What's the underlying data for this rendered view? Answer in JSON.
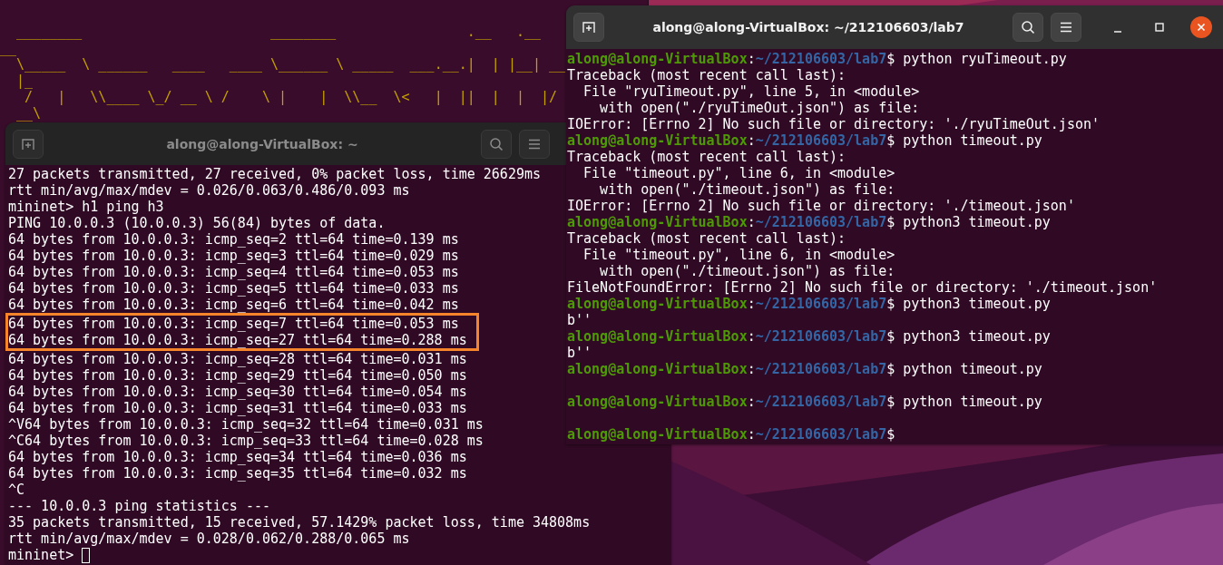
{
  "background_terminal": {
    "ascii_lines": [
      "  ________                       ________                .__   .__",
      "__",
      "  \\_____  \\ ______   ____   ____ \\______ \\ _____  ___.__.|  | |__| __",
      "  |_",
      "   /   |   \\\\____ \\_/ __ \\ /    \\ |    |  \\\\__  \\<   |  ||  |  |  |/",
      "  __\\"
    ]
  },
  "left_window": {
    "title": "along@along-VirtualBox: ~",
    "active": false,
    "cursor": true,
    "lines": [
      {
        "text": "27 packets transmitted, 27 received, 0% packet loss, time 26629ms",
        "highlighted": false
      },
      {
        "text": "rtt min/avg/max/mdev = 0.026/0.063/0.486/0.093 ms",
        "highlighted": false
      },
      {
        "text": "mininet> h1 ping h3",
        "highlighted": false
      },
      {
        "text": "PING 10.0.0.3 (10.0.0.3) 56(84) bytes of data.",
        "highlighted": false
      },
      {
        "text": "64 bytes from 10.0.0.3: icmp_seq=2 ttl=64 time=0.139 ms",
        "highlighted": false
      },
      {
        "text": "64 bytes from 10.0.0.3: icmp_seq=3 ttl=64 time=0.029 ms",
        "highlighted": false
      },
      {
        "text": "64 bytes from 10.0.0.3: icmp_seq=4 ttl=64 time=0.053 ms",
        "highlighted": false
      },
      {
        "text": "64 bytes from 10.0.0.3: icmp_seq=5 ttl=64 time=0.033 ms",
        "highlighted": false
      },
      {
        "text": "64 bytes from 10.0.0.3: icmp_seq=6 ttl=64 time=0.042 ms",
        "highlighted": false
      },
      {
        "text": "64 bytes from 10.0.0.3: icmp_seq=7 ttl=64 time=0.053 ms",
        "highlighted": true
      },
      {
        "text": "64 bytes from 10.0.0.3: icmp_seq=27 ttl=64 time=0.288 ms",
        "highlighted": true
      },
      {
        "text": "64 bytes from 10.0.0.3: icmp_seq=28 ttl=64 time=0.031 ms",
        "highlighted": false
      },
      {
        "text": "64 bytes from 10.0.0.3: icmp_seq=29 ttl=64 time=0.050 ms",
        "highlighted": false
      },
      {
        "text": "64 bytes from 10.0.0.3: icmp_seq=30 ttl=64 time=0.054 ms",
        "highlighted": false
      },
      {
        "text": "64 bytes from 10.0.0.3: icmp_seq=31 ttl=64 time=0.033 ms",
        "highlighted": false
      },
      {
        "text": "^V64 bytes from 10.0.0.3: icmp_seq=32 ttl=64 time=0.031 ms",
        "highlighted": false
      },
      {
        "text": "^C64 bytes from 10.0.0.3: icmp_seq=33 ttl=64 time=0.028 ms",
        "highlighted": false
      },
      {
        "text": "64 bytes from 10.0.0.3: icmp_seq=34 ttl=64 time=0.036 ms",
        "highlighted": false
      },
      {
        "text": "64 bytes from 10.0.0.3: icmp_seq=35 ttl=64 time=0.032 ms",
        "highlighted": false
      },
      {
        "text": "^C",
        "highlighted": false
      },
      {
        "text": "--- 10.0.0.3 ping statistics ---",
        "highlighted": false
      },
      {
        "text": "35 packets transmitted, 15 received, 57.1429% packet loss, time 34808ms",
        "highlighted": false
      },
      {
        "text": "rtt min/avg/max/mdev = 0.028/0.062/0.288/0.065 ms",
        "highlighted": false
      },
      {
        "text": "mininet> ",
        "highlighted": false
      }
    ]
  },
  "right_window": {
    "title": "along@along-VirtualBox: ~/212106603/lab7",
    "active": true,
    "lines": [
      {
        "kind": "prompt",
        "user": "along@along-VirtualBox",
        "separator": ":",
        "path": "~/212106603/lab7",
        "command": "$ python ryuTimeout.py"
      },
      {
        "kind": "output",
        "text": "Traceback (most recent call last):"
      },
      {
        "kind": "output",
        "text": "  File \"ryuTimeout.py\", line 5, in <module>"
      },
      {
        "kind": "output",
        "text": "    with open(\"./ryuTimeOut.json\") as file:"
      },
      {
        "kind": "output",
        "text": "IOError: [Errno 2] No such file or directory: './ryuTimeOut.json'"
      },
      {
        "kind": "prompt",
        "user": "along@along-VirtualBox",
        "separator": ":",
        "path": "~/212106603/lab7",
        "command": "$ python timeout.py"
      },
      {
        "kind": "output",
        "text": "Traceback (most recent call last):"
      },
      {
        "kind": "output",
        "text": "  File \"timeout.py\", line 6, in <module>"
      },
      {
        "kind": "output",
        "text": "    with open(\"./timeout.json\") as file:"
      },
      {
        "kind": "output",
        "text": "IOError: [Errno 2] No such file or directory: './timeout.json'"
      },
      {
        "kind": "prompt",
        "user": "along@along-VirtualBox",
        "separator": ":",
        "path": "~/212106603/lab7",
        "command": "$ python3 timeout.py"
      },
      {
        "kind": "output",
        "text": "Traceback (most recent call last):"
      },
      {
        "kind": "output",
        "text": "  File \"timeout.py\", line 6, in <module>"
      },
      {
        "kind": "output",
        "text": "    with open(\"./timeout.json\") as file:"
      },
      {
        "kind": "output",
        "text": "FileNotFoundError: [Errno 2] No such file or directory: './timeout.json'"
      },
      {
        "kind": "prompt",
        "user": "along@along-VirtualBox",
        "separator": ":",
        "path": "~/212106603/lab7",
        "command": "$ python3 timeout.py"
      },
      {
        "kind": "output",
        "text": "b''"
      },
      {
        "kind": "prompt",
        "user": "along@along-VirtualBox",
        "separator": ":",
        "path": "~/212106603/lab7",
        "command": "$ python3 timeout.py"
      },
      {
        "kind": "output",
        "text": "b''"
      },
      {
        "kind": "prompt",
        "user": "along@along-VirtualBox",
        "separator": ":",
        "path": "~/212106603/lab7",
        "command": "$ python timeout.py"
      },
      {
        "kind": "blank"
      },
      {
        "kind": "prompt",
        "user": "along@along-VirtualBox",
        "separator": ":",
        "path": "~/212106603/lab7",
        "command": "$ python timeout.py"
      },
      {
        "kind": "blank"
      },
      {
        "kind": "prompt",
        "user": "along@along-VirtualBox",
        "separator": ":",
        "path": "~/212106603/lab7",
        "command": "$"
      }
    ]
  }
}
